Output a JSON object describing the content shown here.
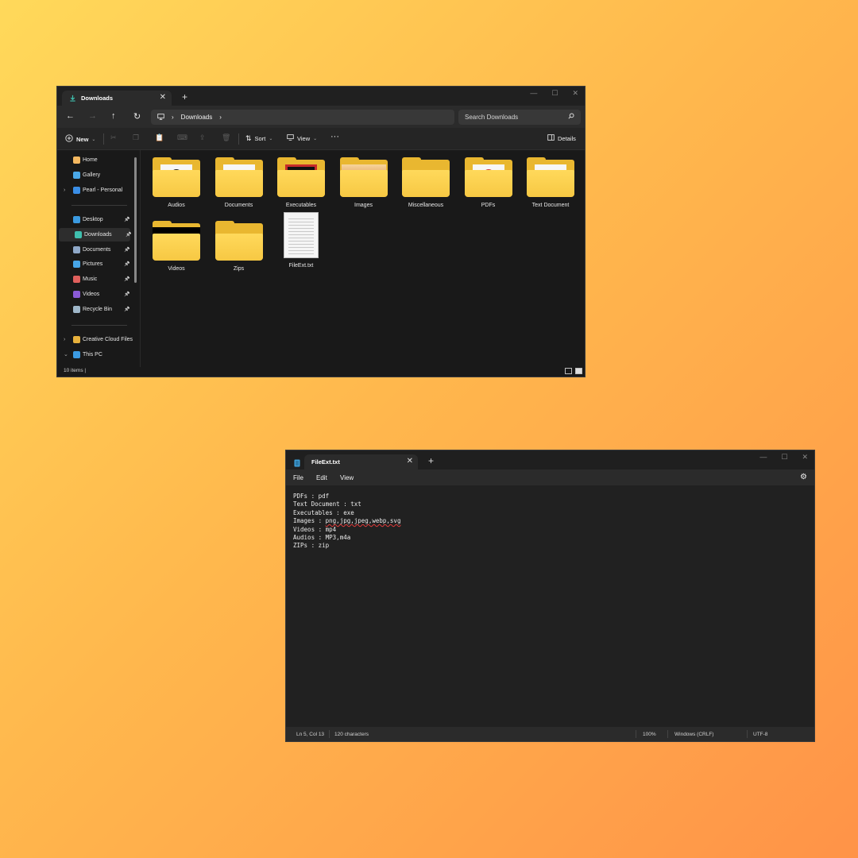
{
  "explorer": {
    "tab_title": "Downloads",
    "tab_close": "✕",
    "new_tab": "+",
    "window_controls": [
      "—",
      "☐",
      "✕"
    ],
    "nav": {
      "back": "←",
      "forward": "→",
      "up": "↑",
      "refresh": "↻"
    },
    "breadcrumb": {
      "computer_icon": "computer-icon",
      "sep": "›",
      "current": "Downloads",
      "trail": "›"
    },
    "search_placeholder": "Search Downloads",
    "toolbar": {
      "new_label": "New",
      "sort_label": "Sort",
      "view_label": "View",
      "more": "···",
      "details_label": "Details"
    },
    "sidebar": {
      "quick": [
        {
          "label": "Home",
          "icon": "home-icon",
          "color": "#f4b860"
        },
        {
          "label": "Gallery",
          "icon": "gallery-icon",
          "color": "#4aa8e8"
        },
        {
          "label": "Pearl - Personal",
          "icon": "onedrive-icon",
          "color": "#3a8ee6",
          "chevron": "›"
        }
      ],
      "pinned": [
        {
          "label": "Desktop",
          "icon": "desktop-icon",
          "color": "#3b9ae1"
        },
        {
          "label": "Downloads",
          "icon": "downloads-icon",
          "color": "#3fbfae",
          "selected": true
        },
        {
          "label": "Documents",
          "icon": "documents-icon",
          "color": "#8fa8c8"
        },
        {
          "label": "Pictures",
          "icon": "pictures-icon",
          "color": "#47a6e8"
        },
        {
          "label": "Music",
          "icon": "music-icon",
          "color": "#e0605c"
        },
        {
          "label": "Videos",
          "icon": "videos-icon",
          "color": "#8a5ad6"
        },
        {
          "label": "Recycle Bin",
          "icon": "recycle-bin-icon",
          "color": "#9fb7c9"
        }
      ],
      "more": [
        {
          "label": "Creative Cloud Files",
          "icon": "creative-cloud-icon",
          "color": "#e8b13c",
          "chevron": "›"
        },
        {
          "label": "This PC",
          "icon": "this-pc-icon",
          "color": "#3b9ae1",
          "chevron": "⌄"
        }
      ],
      "pin_glyph": "📌"
    },
    "items": [
      {
        "label": "Audios",
        "thumb": "audio"
      },
      {
        "label": "Documents",
        "thumb": "doc"
      },
      {
        "label": "Executables",
        "thumb": "exe"
      },
      {
        "label": "Images",
        "thumb": "photo"
      },
      {
        "label": "Miscellaneous",
        "thumb": "empty"
      },
      {
        "label": "PDFs",
        "thumb": "pdf"
      },
      {
        "label": "Text Document",
        "thumb": "doc"
      },
      {
        "label": "Videos",
        "thumb": "video"
      },
      {
        "label": "Zips",
        "thumb": "empty"
      },
      {
        "label": "FileExt.txt",
        "thumb": "file"
      }
    ],
    "status": {
      "count": "10 items",
      "cursor": "|"
    }
  },
  "notepad": {
    "tab_title": "FileExt.txt",
    "tab_close": "✕",
    "new_tab": "+",
    "window_controls": [
      "—",
      "☐",
      "✕"
    ],
    "menu": [
      "File",
      "Edit",
      "View"
    ],
    "lines": [
      "PDFs : pdf",
      "Text Document : txt",
      "Executables : exe",
      "Images : png,jpg,jpeg,webp,svg",
      "Videos : mp4",
      "Audios : MP3,m4a",
      "ZIPs : zip"
    ],
    "status": {
      "position": "Ln 5, Col 13",
      "characters": "120 characters",
      "zoom": "100%",
      "line_ending": "Windows (CRLF)",
      "encoding": "UTF-8"
    }
  }
}
